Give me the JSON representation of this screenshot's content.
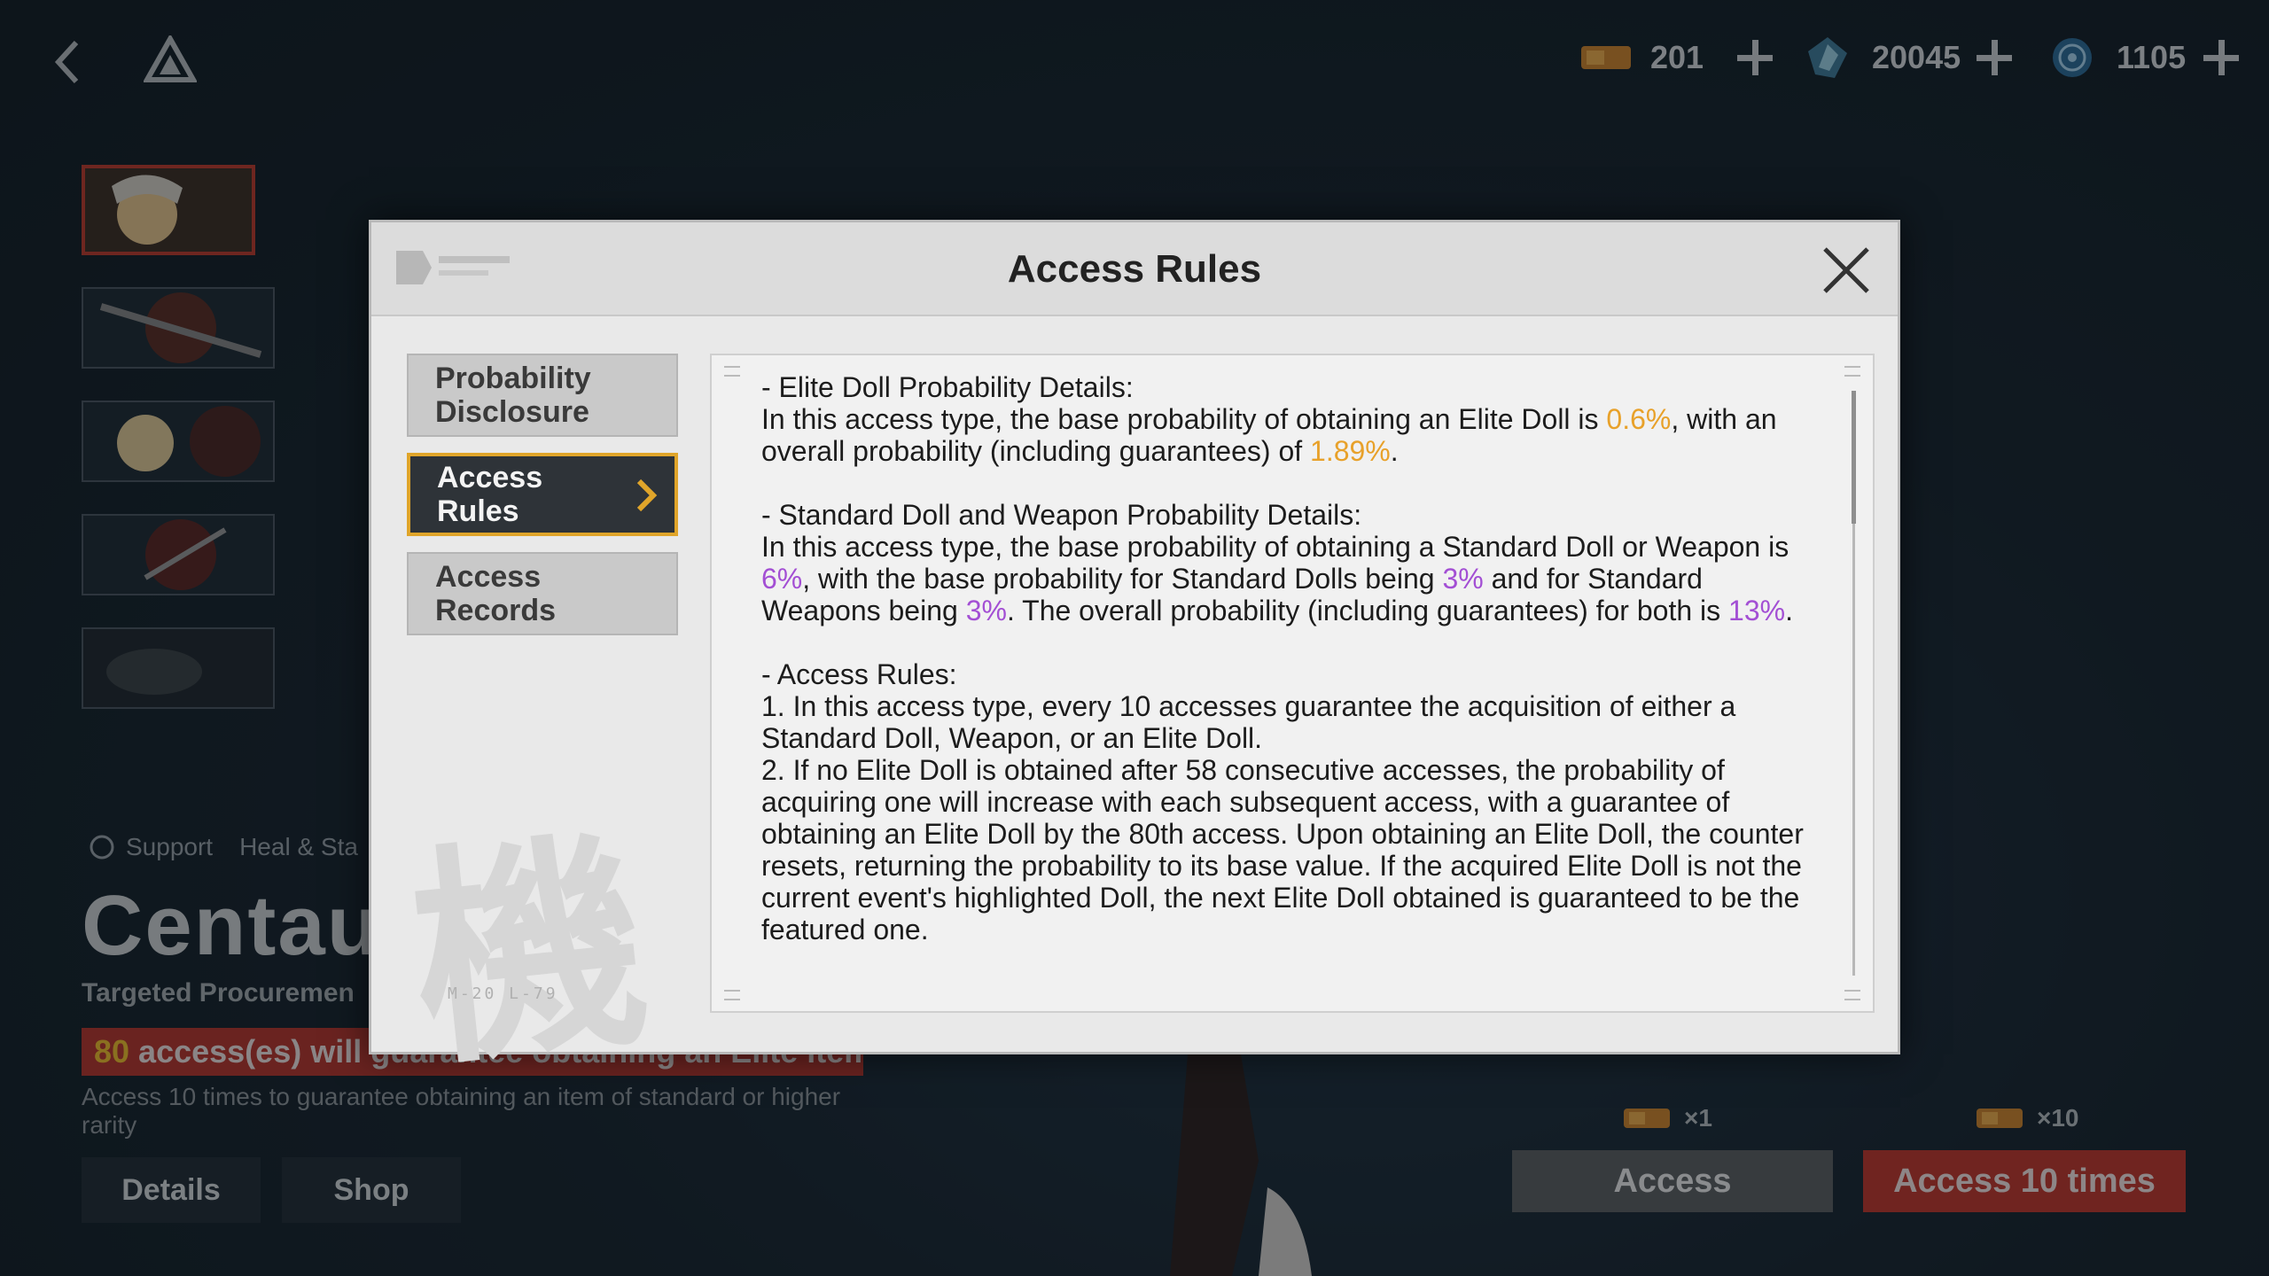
{
  "currencies": [
    {
      "icon": "ticket-icon",
      "value": "201"
    },
    {
      "icon": "crystal-icon",
      "value": "20045"
    },
    {
      "icon": "coin-icon",
      "value": "1105"
    }
  ],
  "banner_info": {
    "tags": [
      "Support",
      "Heal & Sta"
    ],
    "title": "Centau",
    "subtitle": "Targeted Procuremen",
    "guarantee_number": "80",
    "guarantee_text": " access(es) will guarantee obtaining an Elite item",
    "access_desc": "Access 10 times to guarantee obtaining an item of standard or higher rarity",
    "details_label": "Details",
    "shop_label": "Shop"
  },
  "actions": {
    "single_cost": "×1",
    "ten_cost": "×10",
    "single_label": "Access",
    "ten_label": "Access 10 times"
  },
  "modal": {
    "title": "Access Rules",
    "nav": [
      {
        "label": "Probability Disclosure",
        "active": false
      },
      {
        "label": "Access Rules",
        "active": true
      },
      {
        "label": "Access Records",
        "active": false
      }
    ],
    "kanji": "機",
    "serial": "M-20 L-79",
    "content": {
      "elite_heading": "- Elite Doll Probability Details:",
      "elite_p1_a": "In this access type, the base probability of obtaining an Elite Doll is ",
      "elite_base": "0.6%",
      "elite_p1_b": ", with an overall probability (including guarantees) of ",
      "elite_overall": "1.89%",
      "elite_p1_c": ".",
      "std_heading": "- Standard Doll and Weapon Probability Details:",
      "std_a": "In this access type, the base probability of obtaining a Standard Doll or Weapon is ",
      "std_base": "6%",
      "std_b": ", with the base probability for Standard Dolls being ",
      "std_doll": "3%",
      "std_c": " and for Standard Weapons being ",
      "std_weapon": "3%",
      "std_d": ". The overall probability (including guarantees) for both is ",
      "std_overall": "13%",
      "std_e": ".",
      "rules_heading": "- Access Rules:",
      "rule1": "1. In this access type, every 10 accesses guarantee the acquisition of either a Standard Doll, Weapon, or an Elite Doll.",
      "rule2": "2. If no Elite Doll is obtained after 58 consecutive accesses, the probability of acquiring one will increase with each subsequent access, with a guarantee of obtaining an Elite Doll by the 80th access. Upon obtaining an Elite Doll, the counter resets, returning the probability to its base value. If the acquired Elite Doll is not the current event's highlighted Doll, the next Elite Doll obtained is guaranteed to be the featured one."
    }
  },
  "colors": {
    "accent_red": "#c4362b",
    "highlight_orange": "#e8a12a",
    "highlight_purple": "#a34fd4",
    "active_border": "#e0a52a"
  }
}
